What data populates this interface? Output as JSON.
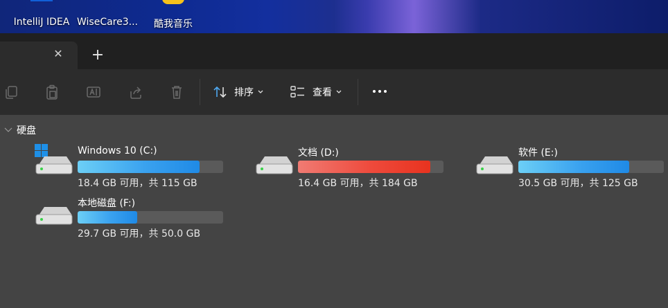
{
  "desktop": {
    "icons": [
      {
        "label": "IntelliJ IDEA",
        "icon": "intellij-idea-icon"
      },
      {
        "label": "WiseCare3...",
        "icon": "wisecare-shield-icon"
      },
      {
        "label": "酷我音乐",
        "icon": "kuwo-music-icon"
      }
    ]
  },
  "tabs": {
    "close_symbol": "✕",
    "new_tab_symbol": "+"
  },
  "toolbar": {
    "icons": [
      "copy-icon",
      "paste-icon",
      "rename-icon",
      "share-icon",
      "delete-icon"
    ],
    "sort_label": "排序",
    "view_label": "查看",
    "more_icon": "more-icon"
  },
  "group": {
    "label": "硬盘"
  },
  "drives": [
    {
      "name": "Windows 10 (C:)",
      "info": "18.4 GB 可用，共 115 GB",
      "used_fraction": 0.84,
      "color": "blue",
      "system": true
    },
    {
      "name": "文档 (D:)",
      "info": "16.4 GB 可用，共 184 GB",
      "used_fraction": 0.91,
      "color": "red",
      "system": false
    },
    {
      "name": "软件 (E:)",
      "info": "30.5 GB 可用，共 125 GB",
      "used_fraction": 0.76,
      "color": "blue",
      "system": false
    },
    {
      "name": "本地磁盘 (F:)",
      "info": "29.7 GB 可用，共 50.0 GB",
      "used_fraction": 0.41,
      "color": "blue",
      "system": false
    }
  ],
  "colors": {
    "accent_blue": "#1f8ae6",
    "warning_red": "#e8331f",
    "background": "#434343",
    "toolbar": "#2c2c2c",
    "tabbar": "#202020"
  }
}
